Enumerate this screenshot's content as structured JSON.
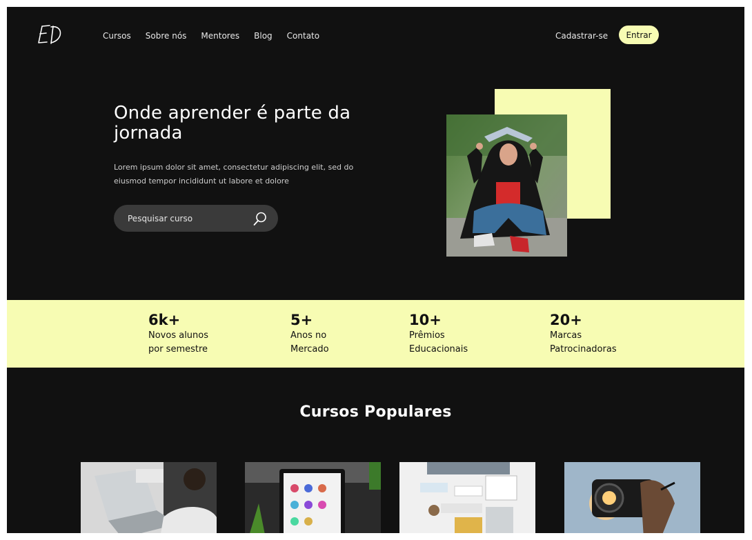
{
  "header": {
    "logo_text": "ED",
    "nav": [
      "Cursos",
      "Sobre nós",
      "Mentores",
      "Blog",
      "Contato"
    ],
    "signup_label": "Cadastrar-se",
    "login_label": "Entrar"
  },
  "hero": {
    "title": "Onde aprender é parte da jornada",
    "description": "Lorem ipsum dolor sit amet, consectetur adipiscing elit, sed do eiusmod tempor incididunt ut labore et dolore",
    "search_placeholder": "Pesquisar curso"
  },
  "stats": [
    {
      "value": "6k+",
      "label": "Novos alunos por semestre"
    },
    {
      "value": "5+",
      "label": "Anos no Mercado"
    },
    {
      "value": "10+",
      "label": "Prêmios Educacionais"
    },
    {
      "value": "20+",
      "label": "Marcas Patrocinadoras"
    }
  ],
  "courses": {
    "title": "Cursos Populares"
  },
  "colors": {
    "background": "#111111",
    "accent": "#f7fcb3",
    "search_bg": "#3a3a3a"
  }
}
